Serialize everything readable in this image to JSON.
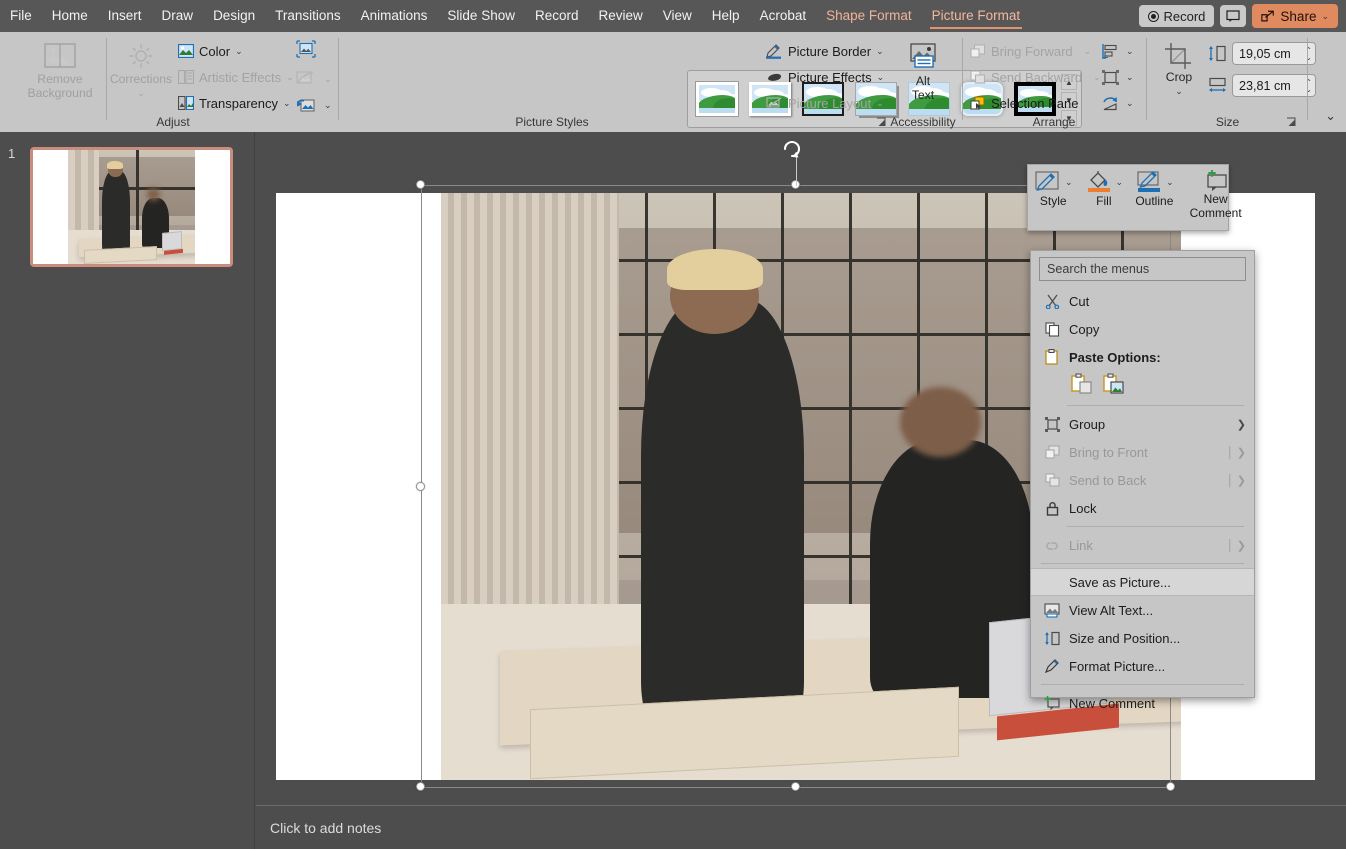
{
  "menubar": {
    "items": [
      {
        "label": "File",
        "state": "normal"
      },
      {
        "label": "Home",
        "state": "normal"
      },
      {
        "label": "Insert",
        "state": "normal"
      },
      {
        "label": "Draw",
        "state": "normal"
      },
      {
        "label": "Design",
        "state": "normal"
      },
      {
        "label": "Transitions",
        "state": "normal"
      },
      {
        "label": "Animations",
        "state": "normal"
      },
      {
        "label": "Slide Show",
        "state": "normal"
      },
      {
        "label": "Record",
        "state": "normal"
      },
      {
        "label": "Review",
        "state": "normal"
      },
      {
        "label": "View",
        "state": "normal"
      },
      {
        "label": "Help",
        "state": "normal"
      },
      {
        "label": "Acrobat",
        "state": "normal"
      },
      {
        "label": "Shape Format",
        "state": "contextual"
      },
      {
        "label": "Picture Format",
        "state": "active"
      }
    ],
    "record_button": "Record",
    "comments_icon": "comment-icon",
    "share_button": "Share",
    "accent_color": "#e08a60"
  },
  "ribbon": {
    "adjust": {
      "group_label": "Adjust",
      "remove_background": "Remove Background",
      "corrections": "Corrections",
      "color": "Color",
      "artistic_effects": "Artistic Effects",
      "transparency": "Transparency",
      "compress_pictures_icon": "compress-pictures-icon",
      "change_picture_icon": "change-picture-icon",
      "reset_picture_icon": "reset-picture-icon"
    },
    "picture_styles": {
      "group_label": "Picture Styles",
      "styles": [
        {
          "name": "Simple Frame, White",
          "selected": false
        },
        {
          "name": "Beveled Matte, White",
          "selected": false
        },
        {
          "name": "Metal Frame",
          "selected": false
        },
        {
          "name": "Drop Shadow Rectangle",
          "selected": false
        },
        {
          "name": "Reflected Rounded Rectangle",
          "selected": false
        },
        {
          "name": "Soft Edge Rectangle",
          "selected": false
        },
        {
          "name": "Thick Black Frame",
          "selected": true
        }
      ],
      "scroll_up": "▲",
      "scroll_down": "▼",
      "more": "▼"
    },
    "picture_format": {
      "picture_border": "Picture Border",
      "picture_effects": "Picture Effects",
      "picture_layout": "Picture Layout"
    },
    "accessibility": {
      "group_label": "Accessibility",
      "alt_text_line1": "Alt",
      "alt_text_line2": "Text"
    },
    "arrange": {
      "group_label": "Arrange",
      "bring_forward": "Bring Forward",
      "send_backward": "Send Backward",
      "selection_pane": "Selection Pane",
      "align_icon": "align-objects-icon",
      "group_icon": "group-objects-icon",
      "rotate_icon": "rotate-objects-icon"
    },
    "size": {
      "group_label": "Size",
      "crop": "Crop",
      "height_value": "19,05 cm",
      "width_value": "23,81 cm",
      "height_icon": "shape-height-icon",
      "width_icon": "shape-width-icon"
    },
    "collapse_ribbon": "⌄"
  },
  "thumbnail_pane": {
    "slide_number": "1",
    "slide_alt": "office-photo-two-people-at-desk"
  },
  "slide": {
    "picture_name": "office-photo-two-people-at-desk",
    "selection": "picture-selected",
    "rotate_handle": "rotate-handle"
  },
  "mini_toolbar": {
    "style": "Style",
    "fill": "Fill",
    "outline": "Outline",
    "new_comment_line1": "New",
    "new_comment_line2": "Comment",
    "fill_color": "#ED7D31",
    "outline_color": "#1F6FB4"
  },
  "context_menu": {
    "search_placeholder": "Search the menus",
    "items": [
      {
        "label": "Cut",
        "icon": "scissors-icon",
        "state": "normal",
        "submenu": false,
        "accel": "t"
      },
      {
        "label": "Copy",
        "icon": "copy-icon",
        "state": "normal",
        "submenu": false,
        "accel": "C"
      },
      {
        "label": "Paste Options:",
        "icon": "paste-icon",
        "state": "header",
        "submenu": false
      },
      {
        "label": "Group",
        "icon": "group-icon",
        "state": "normal",
        "submenu": true
      },
      {
        "label": "Bring to Front",
        "icon": "bring-to-front-icon",
        "state": "disabled",
        "submenu": true
      },
      {
        "label": "Send to Back",
        "icon": "send-to-back-icon",
        "state": "disabled",
        "submenu": true
      },
      {
        "label": "Lock",
        "icon": "lock-icon",
        "state": "normal",
        "submenu": false
      },
      {
        "label": "Link",
        "icon": "link-icon",
        "state": "disabled",
        "submenu": true
      },
      {
        "label": "Save as Picture...",
        "icon": "none",
        "state": "highlighted",
        "submenu": false
      },
      {
        "label": "View Alt Text...",
        "icon": "alt-text-icon",
        "state": "normal",
        "submenu": false
      },
      {
        "label": "Size and Position...",
        "icon": "size-position-icon",
        "state": "normal",
        "submenu": false
      },
      {
        "label": "Format Picture...",
        "icon": "format-picture-icon",
        "state": "normal",
        "submenu": false
      },
      {
        "label": "New Comment",
        "icon": "new-comment-icon",
        "state": "normal",
        "submenu": false
      }
    ],
    "paste_options": [
      {
        "name": "paste-keep-source-formatting-icon"
      },
      {
        "name": "paste-picture-icon"
      }
    ]
  },
  "notes": {
    "placeholder": "Click to add notes"
  }
}
